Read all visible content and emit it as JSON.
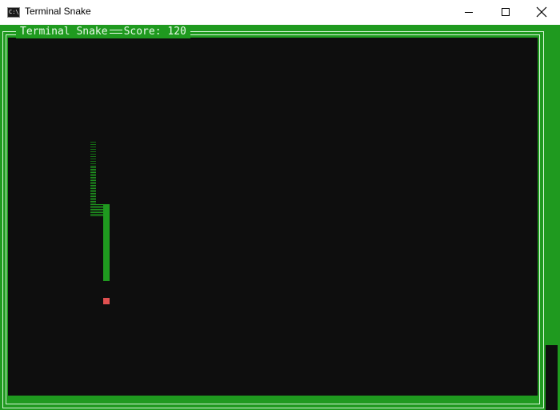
{
  "window": {
    "title": "Terminal Snake",
    "app_icon_glyph": "C:\\_",
    "controls": [
      "minimize",
      "maximize",
      "close"
    ]
  },
  "game": {
    "title": "Terminal Snake",
    "score_label": "Score: 120",
    "score": 120
  },
  "colors": {
    "border_green": "#1f9a1f",
    "play_background": "#0e0e0e",
    "snake": "#1f9a1f",
    "food": "#e05050"
  }
}
